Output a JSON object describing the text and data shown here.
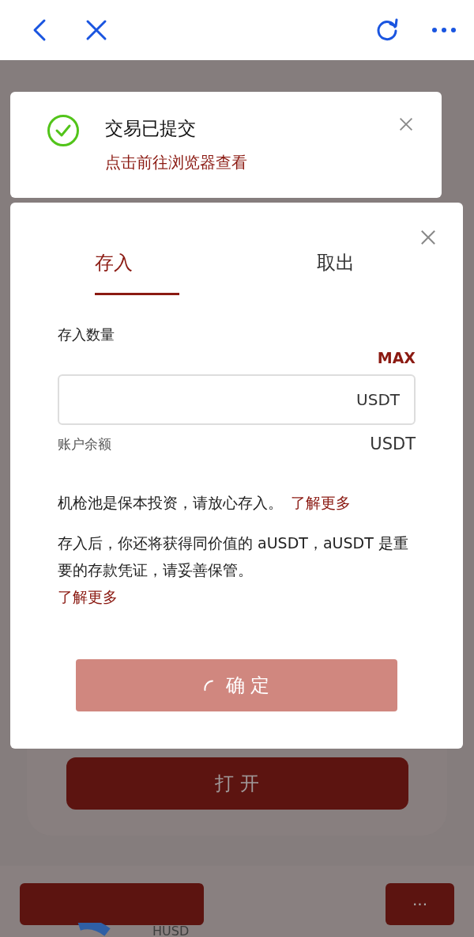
{
  "toast": {
    "title": "交易已提交",
    "link": "点击前往浏览器查看"
  },
  "modal": {
    "tabs": [
      {
        "label": "存入",
        "selected": true
      },
      {
        "label": "取出",
        "selected": false
      }
    ],
    "amount_label": "存入数量",
    "max": "MAX",
    "unit": "USDT",
    "balance_label": "账户余额",
    "balance_unit": "USDT",
    "note1": "机枪池是保本投资，请放心存入。",
    "note1_link": "了解更多",
    "note2": "存入后，你还将获得同价值的 aUSDT，aUSDT 是重要的存款凭证，请妥善保管。",
    "note2_link": "了解更多",
    "confirm": {
      "label": "确 定",
      "loading": true
    }
  },
  "background": {
    "open_button": "打 开",
    "token": "HUSD",
    "more_button": "···"
  }
}
